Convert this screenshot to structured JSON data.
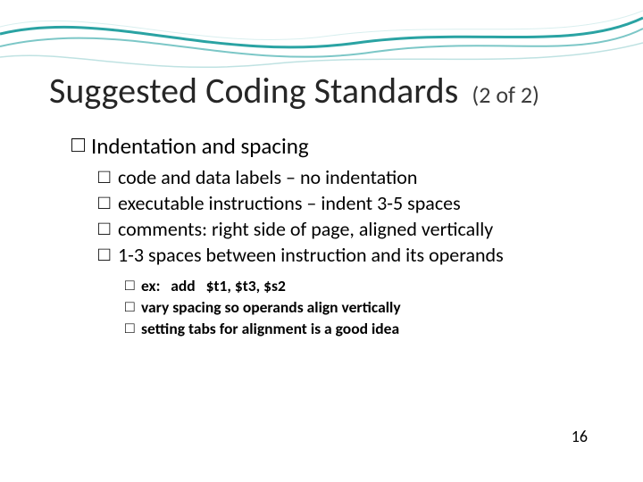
{
  "page_number": "16",
  "title": {
    "main": "Suggested Coding Standards",
    "suffix": "(2 of 2)"
  },
  "bullets": {
    "lvl1": {
      "text": "Indentation and spacing"
    },
    "lvl2": [
      {
        "text": "code and data labels – no indentation"
      },
      {
        "text": "executable instructions – indent 3-5 spaces"
      },
      {
        "text": "comments: right side of page, aligned vertically"
      },
      {
        "text": "1-3 spaces between instruction and its operands"
      }
    ],
    "lvl3": [
      {
        "text": "ex:   add   $t1, $t3, $s2"
      },
      {
        "text": "vary spacing so operands align vertically"
      },
      {
        "text": "setting tabs for alignment is a good idea"
      }
    ]
  },
  "glyphs": {
    "box": "□"
  }
}
